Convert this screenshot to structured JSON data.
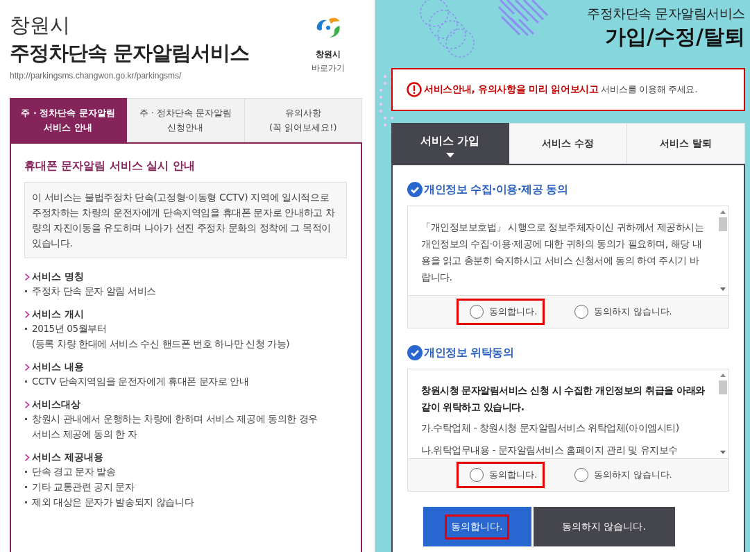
{
  "left": {
    "city": "창원시",
    "title": "주정차단속 문자알림서비스",
    "url": "http://parkingsms.changwon.go.kr/parkingsms/",
    "logo_link": {
      "name": "창원시",
      "label": "바로가기"
    },
    "tabs": [
      {
        "lines": [
          "주 · 정차단속 문자알림",
          "서비스 안내"
        ],
        "selected": true
      },
      {
        "lines": [
          "주 · 정차단속 문자알림",
          "신청안내"
        ],
        "selected": false
      },
      {
        "lines": [
          "유의사항",
          "(꼭 읽어보세요!)"
        ],
        "selected": false
      }
    ],
    "heading": "휴대폰 문자알림 서비스 실시 안내",
    "intro": "이 서비스는 불법주정차 단속(고정형·이동형 CCTV) 지역에 일시적으로 주정차하는 차량의 운전자에게 단속지역임을 휴대폰 문자로 안내하고 차량의 자진이동을 유도하며 나아가 선진 주정차 문화의 정착에 그 목적이 있습니다.",
    "sections": [
      {
        "title": "서비스 명칭",
        "items": [
          [
            "주정차 단속 문자 알림 서비스"
          ]
        ]
      },
      {
        "title": "서비스 개시",
        "items": [
          [
            "2015년 05월부터",
            "(등록 차량 한대에 서비스 수신 핸드폰 번호 하나만 신청 가능)"
          ]
        ]
      },
      {
        "title": "서비스 내용",
        "items": [
          [
            "CCTV 단속지역임을 운전자에게 휴대폰 문자로 안내"
          ]
        ]
      },
      {
        "title": "서비스대상",
        "items": [
          [
            "창원시 관내에서 운행하는 차량에 한하며 서비스 제공에 동의한 경우",
            "서비스 제공에 동의 한 자"
          ]
        ]
      },
      {
        "title": "서비스 제공내용",
        "items": [
          [
            "단속 경고 문자 발송"
          ],
          [
            "기타 교통관련 공지 문자"
          ],
          [
            "제외 대상은 문자가 발송되지 않습니다"
          ]
        ]
      }
    ]
  },
  "right": {
    "subtitle": "주정차단속 문자알림서비스",
    "title": "가입/수정/탈퇴",
    "notice": {
      "emphasis": "서비스안내, 유의사항을 미리 읽어보시고",
      "rest": "서비스를 이용해 주세요."
    },
    "tabs": [
      {
        "label": "서비스 가입",
        "selected": true
      },
      {
        "label": "서비스 수정",
        "selected": false
      },
      {
        "label": "서비스 탈퇴",
        "selected": false
      }
    ],
    "consents": [
      {
        "title": "개인정보 수집·이용·제공 동의",
        "paragraphs": [
          {
            "text": "「개인정보보호법」 시행으로 정보주체자이신 귀하께서 제공하시는 개인정보의 수집·이용·제공에 대한 귀하의 동의가 필요하며, 해당 내용을 읽고 충분히 숙지하시고 서비스 신청서에 동의 하여 주시기 바랍니다.",
            "bold": false
          }
        ],
        "options": [
          {
            "label": "동의합니다.",
            "checked": false,
            "highlighted": true
          },
          {
            "label": "동의하지 않습니다.",
            "checked": false,
            "highlighted": false
          }
        ]
      },
      {
        "title": "개인정보 위탁동의",
        "paragraphs": [
          {
            "text": "창원시청 문자알림서비스 신청 시 수집한 개인정보의 취급을 아래와 같이 위탁하고 있습니다.",
            "bold": true
          },
          {
            "text": "가.수탁업체 - 창원시청 문자알림서비스 위탁업체(아이엠시티)",
            "bold": false
          },
          {
            "text": "나.위탁업무내용 - 문자알림서비스 홈페이지 관리 및 유지보수",
            "bold": false
          }
        ],
        "options": [
          {
            "label": "동의합니다.",
            "checked": false,
            "highlighted": true
          },
          {
            "label": "동의하지 않습니다.",
            "checked": false,
            "highlighted": false
          }
        ]
      }
    ],
    "buttons": [
      {
        "label": "동의합니다.",
        "kind": "primary",
        "highlighted": true
      },
      {
        "label": "동의하지 않습니다.",
        "kind": "secondary",
        "highlighted": false
      }
    ]
  }
}
